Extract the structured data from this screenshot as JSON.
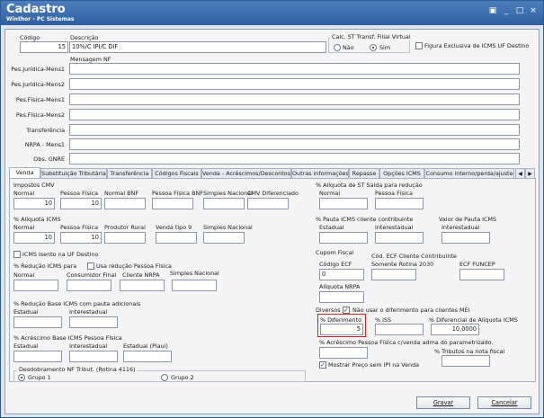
{
  "window": {
    "title": "Cadastro",
    "subtitle": "Winthor - PC Sistemas",
    "controls": [
      "▣",
      "_",
      "□",
      "×"
    ]
  },
  "header": {
    "codigo_label": "Código",
    "codigo_value": "15",
    "descricao_label": "Descrição",
    "descricao_value": "10%/C IPI/C DIF",
    "calc_st_label": "Calc. ST Transf. Filial Virtual",
    "radio_nao": "Não",
    "radio_sim": "Sim",
    "figura_exclusiva_label": "Figura Exclusiva de ICMS UF Destino",
    "mensagem_nf_label": "Mensagem NF"
  },
  "messages": [
    {
      "label": "Pes.Jurídica-Mens1",
      "value": ""
    },
    {
      "label": "Pes.Jurídica-Mens2",
      "value": ""
    },
    {
      "label": "Pes.Física-Mens1",
      "value": ""
    },
    {
      "label": "Pes.Física-Mens2",
      "value": ""
    },
    {
      "label": "Transferência",
      "value": ""
    },
    {
      "label": "NRPA - Mens1",
      "value": ""
    },
    {
      "label": "Obs. GNRE",
      "value": ""
    }
  ],
  "tabs": [
    "Venda",
    "Substituição Tributária",
    "Transferência",
    "Códigos Fiscais",
    "Venda - Acréscimos/Descontos",
    "Outras informações",
    "Repasse",
    "Opções ICMS",
    "Consumo interno/perda/ajuste"
  ],
  "venda": {
    "impostos_cmv": {
      "title": "Impostos CMV",
      "labels": [
        "Normal",
        "Pessoa Física",
        "Normal BNF",
        "Pessoa Física BNF",
        "Simples Nacional",
        "CMV Diferenciado"
      ],
      "values": [
        "10",
        "10",
        "",
        "",
        "",
        ""
      ]
    },
    "aliquota_icms": {
      "title": "% Alíquota ICMS",
      "labels": [
        "Normal",
        "Pessoa Física",
        "Produtor Rural",
        "Venda tipo 9",
        "Simples Nacional"
      ],
      "values": [
        "10",
        "10",
        "",
        "",
        ""
      ]
    },
    "icms_isento_label": "ICMS Isento na UF Destino",
    "reducao_icms": {
      "title": "% Redução ICMS para",
      "usa_reducao_label": "Usa redução Pessoa Física",
      "labels": [
        "Normal",
        "Consumidor Final",
        "Cliente NRPA",
        "Simples Nacional"
      ],
      "values": [
        "",
        "",
        "",
        ""
      ]
    },
    "reducao_base_pauta": {
      "title": "% Redução Base ICMS com pauta adicionais",
      "labels": [
        "Estadual",
        "Interestadual"
      ],
      "values": [
        "",
        ""
      ]
    },
    "acrescimo_base": {
      "title": "% Acréscimo Base ICMS Pessoa Física",
      "labels": [
        "Estadual",
        "Interestadual",
        "Estadual (Piauí)"
      ],
      "values": [
        "",
        "",
        ""
      ]
    },
    "desdobramento": {
      "title": "Desdobramento NF Tribut. (Rotina 4116)",
      "grupo1": "Grupo 1",
      "grupo2": "Grupo 2"
    },
    "aliquota_st": {
      "title": "% Alíquota de ST Saída para redução",
      "labels": [
        "Normal",
        "Pessoa Física"
      ],
      "values": [
        "",
        ""
      ]
    },
    "pauta_icms": {
      "title": "% Pauta ICMS cliente contribuinte",
      "labels": [
        "Estadual",
        "Interestadual"
      ],
      "values": [
        "",
        ""
      ],
      "valor_pauta_title": "Valor de Pauta ICMS",
      "valor_pauta_label": "Interestadual",
      "valor_pauta_value": ""
    },
    "cupom_fiscal": {
      "title": "Cupom Fiscal",
      "codigo_ecf_label": "Código ECF",
      "codigo_ecf_value": "0",
      "cod_ecf_cliente_label": "Cód. ECF Cliente Contribuinte",
      "somente_rotina_label": "Somente Rotina 2030",
      "ecf_funcep_label": "ECF FUNCEP",
      "aliquota_nrpa_label": "Alíquota NRPA"
    },
    "diversos": {
      "title": "Diversos",
      "nao_usar_label": "Não usar o diferimento para clientes MEI",
      "diferimento_label": "% Diferimento",
      "diferimento_value": "5",
      "iss_label": "% ISS",
      "iss_value": "",
      "diferencial_label": "% Diferencial de Alíquota ICMS",
      "diferencial_value": "10,0000",
      "acrescimo_pf_label": "% Acréscimo Pessoa Física c/venda adma do parametrizado.",
      "tributos_label": "% Tributos na nota fiscal",
      "mostrar_preco_label": "Mostrar Preço sem IPI na Venda"
    }
  },
  "footer": {
    "gravar_label": "Gravar",
    "cancelar_label": "Cancelar"
  }
}
